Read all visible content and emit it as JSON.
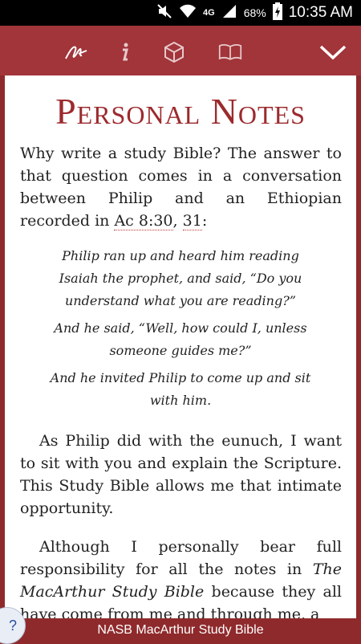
{
  "status_bar": {
    "network": "4G",
    "battery": "68%",
    "time": "10:35 AM"
  },
  "toolbar": {
    "icons": [
      "signature-icon",
      "info-icon",
      "cube-icon",
      "book-icon",
      "chevron-down-icon"
    ]
  },
  "page": {
    "title": "Personal Notes",
    "p1_text": "Why write a study Bible? The answer to that question comes in a conversation between Philip and an Ethiopian recorded in ",
    "ref1": "Ac 8:30",
    "ref_sep": ", ",
    "ref2": "31",
    "p1_end": ":",
    "quote1": "Philip ran up and heard him reading Isaiah the prophet, and said, “Do you understand what you are reading?”",
    "quote2": "And he said, “Well, how could I, unless someone guides me?”",
    "quote3": "And he invited Philip to come up and sit with him.",
    "p2": "As Philip did with the eunuch, I want to sit with you and explain the Scripture. This Study Bible allows me that intimate opportunity.",
    "p3_a": "Although I personally bear full responsibility for all the notes in ",
    "p3_title": "The MacArthur Study Bible",
    "p3_b": " because they all have come from me and through me, a"
  },
  "footer": {
    "label": "NASB MacArthur Study Bible",
    "help": "?"
  }
}
